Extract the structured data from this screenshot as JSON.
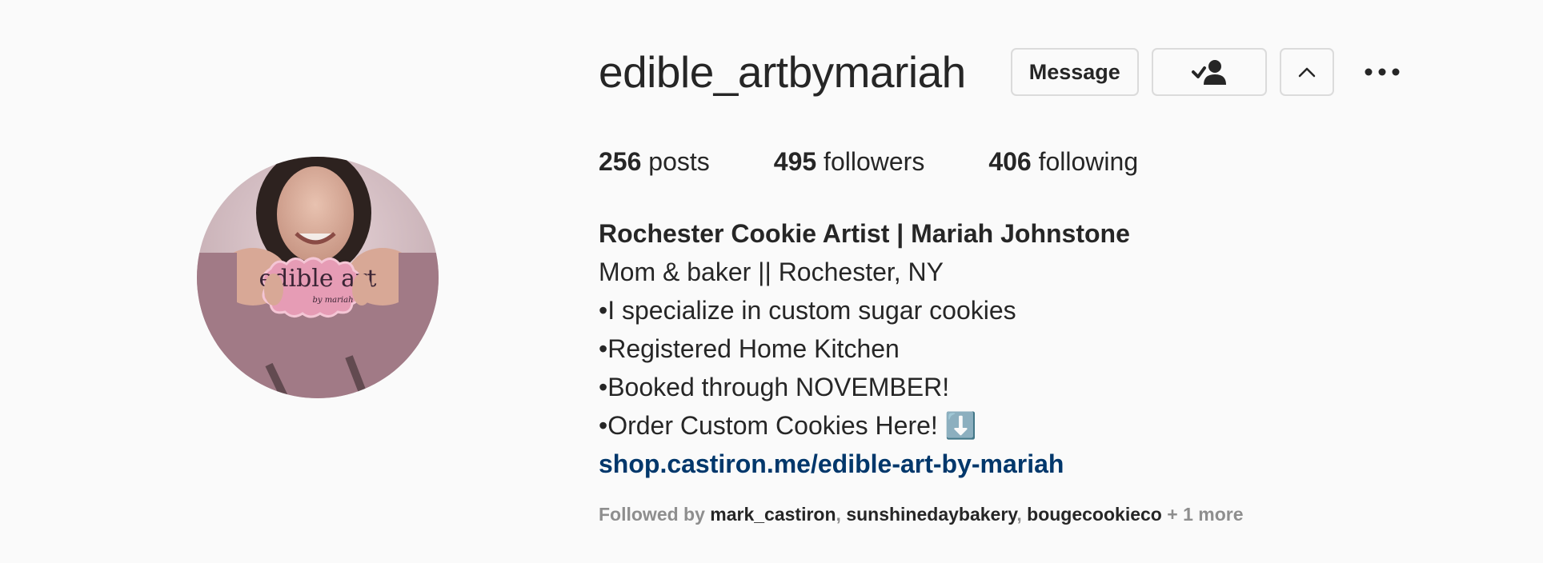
{
  "profile": {
    "username": "edible_artbymariah",
    "avatar_alt": "",
    "buttons": {
      "message_label": "Message",
      "following_icon": "person-check-icon",
      "suggested_icon": "chevron-up-icon",
      "more_icon": "more-horizontal-icon"
    },
    "stats": [
      {
        "count": "256",
        "label": "posts"
      },
      {
        "count": "495",
        "label": "followers"
      },
      {
        "count": "406",
        "label": "following"
      }
    ],
    "bio": {
      "full_name": "Rochester Cookie Artist | Mariah Johnstone",
      "lines": [
        "Mom & baker || Rochester, NY",
        "•I specialize in custom sugar cookies",
        "•Registered Home Kitchen",
        "•Booked through NOVEMBER!",
        "•Order Custom Cookies Here! ⬇️"
      ],
      "link": "shop.castiron.me/edible-art-by-mariah"
    },
    "followed_by": {
      "prefix": "Followed by",
      "accounts": [
        "mark_castiron",
        "sunshinedaybakery",
        "bougecookieco"
      ],
      "more": "+ 1 more"
    },
    "cookie_text": "edible art",
    "cookie_subtext": "by mariah"
  },
  "colors": {
    "background": "#fafafa",
    "text": "#262626",
    "muted": "#8e8e8e",
    "link": "#00376b",
    "border": "#dbdbdb"
  }
}
